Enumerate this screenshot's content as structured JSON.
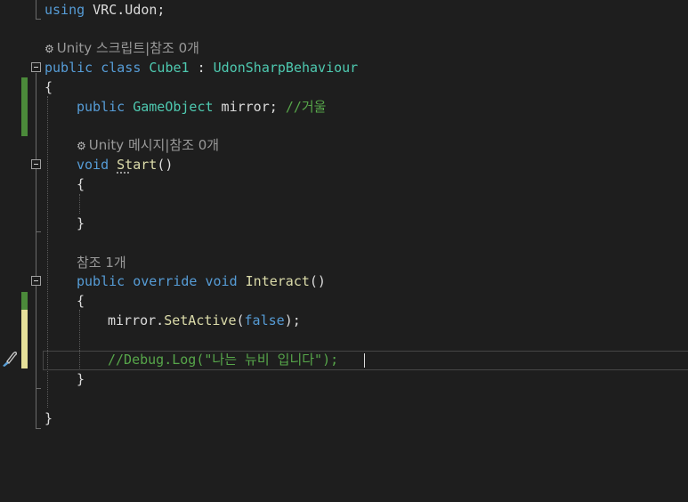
{
  "code": {
    "line_using": {
      "kw": "using",
      "rest": " VRC.Udon;"
    },
    "lens_class": {
      "icon": "unity-icon",
      "text": "Unity 스크립트|참조 0개"
    },
    "line_class": {
      "kw1": "public",
      "kw2": "class",
      "name": "Cube1",
      "sep": " : ",
      "base": "UdonSharpBehaviour"
    },
    "brace_open_class": "{",
    "line_field": {
      "kw": "public",
      "type": "GameObject",
      "name": " mirror;",
      "comment": "//거울"
    },
    "lens_start": {
      "icon": "unity-icon",
      "text": "Unity 메시지|참조 0개"
    },
    "line_start": {
      "kw": "void",
      "name": "Start",
      "paren": "()"
    },
    "brace_open_start": "{",
    "brace_close_start": "}",
    "lens_interact": {
      "text": "참조 1개"
    },
    "line_interact": {
      "kw1": "public",
      "kw2": "override",
      "kw3": "void",
      "name": "Interact",
      "paren": "()"
    },
    "brace_open_interact": "{",
    "line_setactive": {
      "obj": "mirror.",
      "method": "SetActive",
      "open": "(",
      "arg": "false",
      "close": ");"
    },
    "line_debug": {
      "comment": "//Debug.Log(\"나는 뉴비 입니다\");"
    },
    "brace_close_interact": "}",
    "brace_close_class": "}"
  },
  "colors": {
    "keyword": "#569cd6",
    "type": "#4ec9b0",
    "method": "#dcdcaa",
    "comment": "#57a64a",
    "background": "#1e1e1e"
  }
}
